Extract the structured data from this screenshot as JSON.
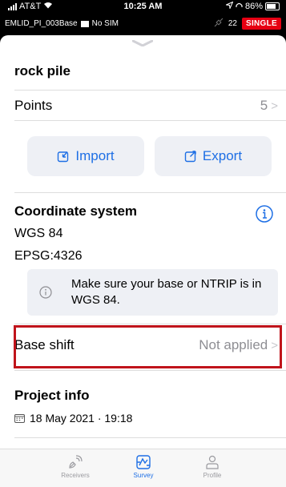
{
  "status_bar": {
    "carrier": "AT&T",
    "time": "10:25 AM",
    "battery": "86%"
  },
  "receiver_bar": {
    "receiver_name": "EMLID_PI_003Base",
    "sim_status": "No SIM",
    "satellites": "22",
    "solution": "SINGLE"
  },
  "project": {
    "title": "rock pile"
  },
  "points": {
    "label": "Points",
    "count": "5"
  },
  "actions": {
    "import_label": "Import",
    "export_label": "Export"
  },
  "coordinate_system": {
    "title": "Coordinate system",
    "name": "WGS 84",
    "epsg": "EPSG:4326",
    "note": "Make sure your base or NTRIP is in WGS 84."
  },
  "base_shift": {
    "label": "Base shift",
    "status": "Not applied"
  },
  "project_info": {
    "title": "Project info",
    "date": "18 May 2021 · 19:18"
  },
  "tabs": [
    {
      "label": "Receivers",
      "icon": "receivers-icon"
    },
    {
      "label": "Survey",
      "icon": "survey-icon",
      "active": true
    },
    {
      "label": "Profile",
      "icon": "profile-icon"
    }
  ],
  "colors": {
    "accent": "#1e6fe5",
    "highlight": "#c0141b",
    "single_badge": "#e60012"
  }
}
